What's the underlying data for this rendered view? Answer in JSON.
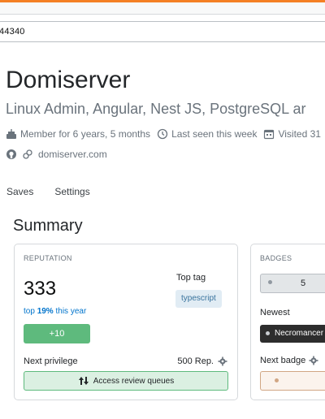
{
  "browser": {
    "url_fragment": "44340"
  },
  "profile": {
    "name": "Domiserver",
    "subtitle": "Linux Admin, Angular, Nest JS, PostgreSQL ar",
    "member_for": "Member for 6 years, 5 months",
    "last_seen": "Last seen this week",
    "visited": "Visited 31",
    "website": "domiserver.com"
  },
  "tabs": [
    {
      "label": "Saves"
    },
    {
      "label": "Settings"
    }
  ],
  "summary": {
    "title": "Summary",
    "reputation": {
      "label": "REPUTATION",
      "value": "333",
      "trend_prefix": "top",
      "trend_percent": "19%",
      "trend_suffix": "this year",
      "gain": "+10",
      "top_tag_label": "Top tag",
      "top_tag": "typescript",
      "next_privilege_label": "Next privilege",
      "next_privilege_rep": "500 Rep.",
      "next_privilege_name": "Access review queues"
    },
    "badges": {
      "label": "BADGES",
      "count": "5",
      "newest_label": "Newest",
      "newest_badge": "Necromancer",
      "next_badge_label": "Next badge"
    }
  },
  "colors": {
    "accent": "#f48024",
    "link": "#0074cc",
    "success": "#5eba7d",
    "tag_bg": "#e1ecf4",
    "tag_text": "#39739d"
  }
}
